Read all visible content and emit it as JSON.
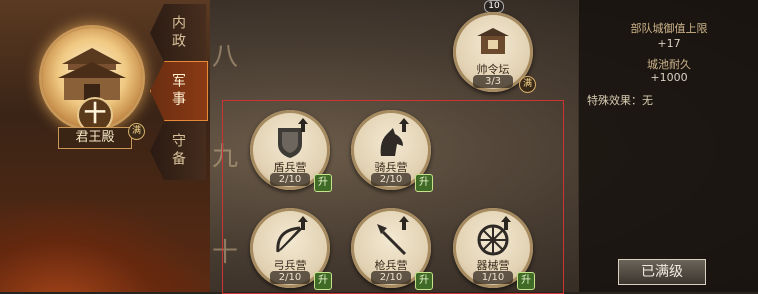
{
  "palace": {
    "name": "君王殿",
    "level": "十",
    "badge": "满"
  },
  "tabs": [
    {
      "label": "内政"
    },
    {
      "label": "军事"
    },
    {
      "label": "守备"
    }
  ],
  "tiers": [
    "八",
    "九",
    "十"
  ],
  "commander": {
    "name": "帅令坛",
    "count": "3/3",
    "badge": "满",
    "top_number": "10"
  },
  "buildings": [
    {
      "name": "盾兵营",
      "count": "2/10",
      "badge": "升",
      "icon": "shield-icon"
    },
    {
      "name": "骑兵营",
      "count": "2/10",
      "badge": "升",
      "icon": "horse-icon"
    },
    {
      "name": "弓兵营",
      "count": "2/10",
      "badge": "升",
      "icon": "bow-icon"
    },
    {
      "name": "枪兵营",
      "count": "2/10",
      "badge": "升",
      "icon": "spear-icon"
    },
    {
      "name": "器械营",
      "count": "1/10",
      "badge": "升",
      "icon": "wheel-icon"
    }
  ],
  "stats": [
    {
      "title": "部队城御值上限",
      "value": "+17"
    },
    {
      "title": "城池耐久",
      "value": "+1000"
    }
  ],
  "special": "特殊效果：无",
  "max_button": "已满级"
}
